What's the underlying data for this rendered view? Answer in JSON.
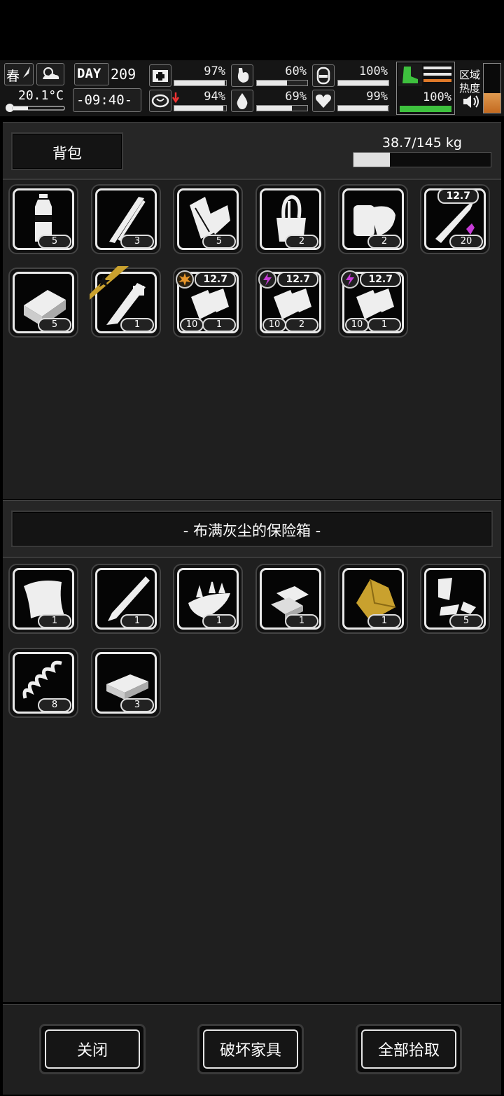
{
  "status": {
    "season": "春",
    "temperature": "20.1°C",
    "day_label": "DAY",
    "day_number": "209",
    "time": "-09:40-",
    "health": "97%",
    "hunger": "60%",
    "armor": "100%",
    "sanity": "94%",
    "thirst": "69%",
    "heart": "99%",
    "stamina": "100%",
    "zone_heat_label_1": "区域",
    "zone_heat_label_2": "热度",
    "levels": {
      "health": 0.97,
      "hunger": 0.6,
      "armor": 1.0,
      "sanity": 0.94,
      "thirst": 0.69,
      "heart": 0.99,
      "stamina": 1.0
    }
  },
  "backpack": {
    "title": "背包",
    "weight": "38.7/145 kg",
    "weight_fraction": 0.267,
    "items": [
      {
        "name": "water-bottle",
        "count": "5"
      },
      {
        "name": "tweezers",
        "count": "3"
      },
      {
        "name": "paper-rolls",
        "count": "5"
      },
      {
        "name": "tool-cup",
        "count": "2"
      },
      {
        "name": "bandage",
        "count": "2"
      },
      {
        "name": "rifle-round",
        "count": "20",
        "badge": "12.7"
      },
      {
        "name": "canned-food",
        "count": "5"
      },
      {
        "name": "caliper",
        "count": "1"
      },
      {
        "name": "ammo-box-explosive",
        "count": "1",
        "count2": "10",
        "badge": "12.7"
      },
      {
        "name": "ammo-box-electric",
        "count": "2",
        "count2": "10",
        "badge": "12.7"
      },
      {
        "name": "ammo-box-electric",
        "count": "1",
        "count2": "10",
        "badge": "12.7"
      }
    ]
  },
  "container": {
    "title": "- 布满灰尘的保险箱 -",
    "items": [
      {
        "name": "cloth",
        "count": "1"
      },
      {
        "name": "metal-rod",
        "count": "1"
      },
      {
        "name": "spiked-scrap",
        "count": "1"
      },
      {
        "name": "silver-bars",
        "count": "1"
      },
      {
        "name": "gold-nugget",
        "count": "1"
      },
      {
        "name": "scrap-pieces",
        "count": "5"
      },
      {
        "name": "spring",
        "count": "8"
      },
      {
        "name": "cash-bundle",
        "count": "3"
      }
    ]
  },
  "buttons": {
    "close": "关闭",
    "destroy": "破坏家具",
    "take_all": "全部拾取"
  },
  "colors": {
    "gold": "#c9a12e",
    "magenta": "#c83cd8",
    "green": "#3ec13e"
  }
}
